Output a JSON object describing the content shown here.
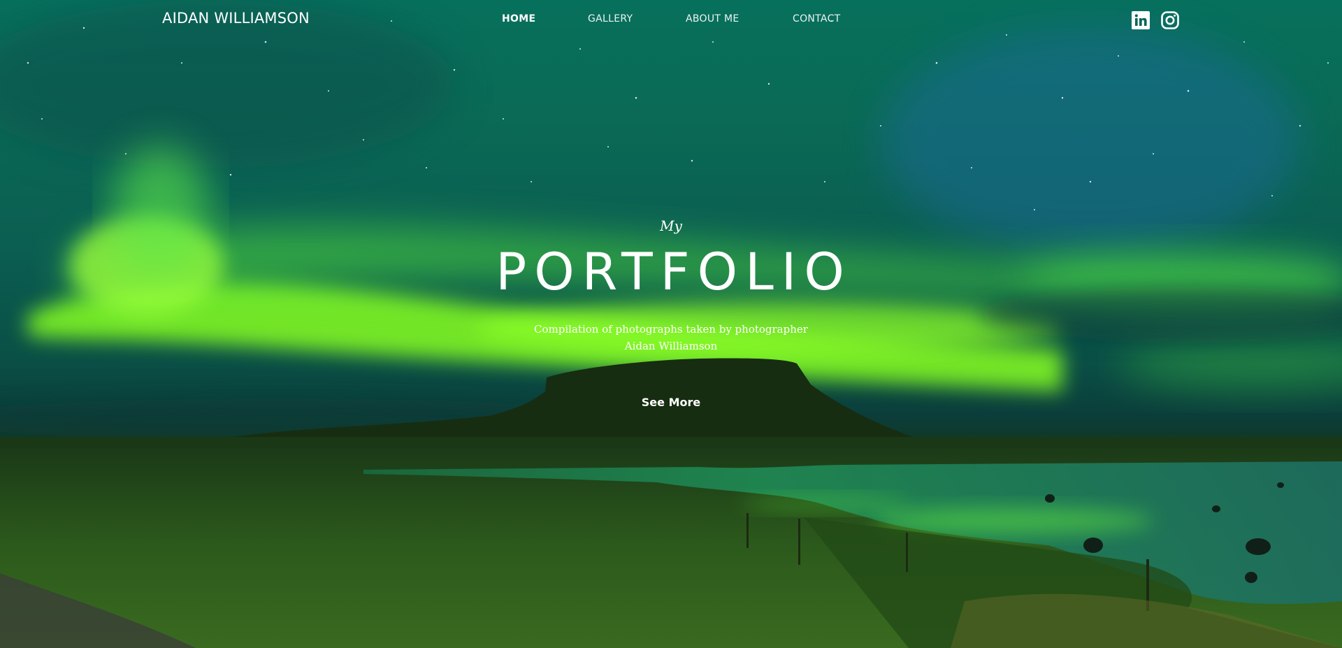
{
  "header": {
    "brand": "AIDAN WILLIAMSON",
    "nav": [
      {
        "label": "HOME",
        "active": true
      },
      {
        "label": "GALLERY",
        "active": false
      },
      {
        "label": "ABOUT ME",
        "active": false
      },
      {
        "label": "CONTACT",
        "active": false
      }
    ],
    "social": [
      {
        "icon": "linkedin-icon"
      },
      {
        "icon": "instagram-icon"
      }
    ]
  },
  "hero": {
    "kicker": "My",
    "title": "PORTFOLIO",
    "subtitle_line1": "Compilation of photographs taken by photographer",
    "subtitle_line2": "Aidan Williamson",
    "cta": "See More"
  },
  "colors": {
    "text": "#ffffff",
    "aurora": "#7dff2a",
    "sky": "#07705c",
    "ground": "#2a5518"
  }
}
